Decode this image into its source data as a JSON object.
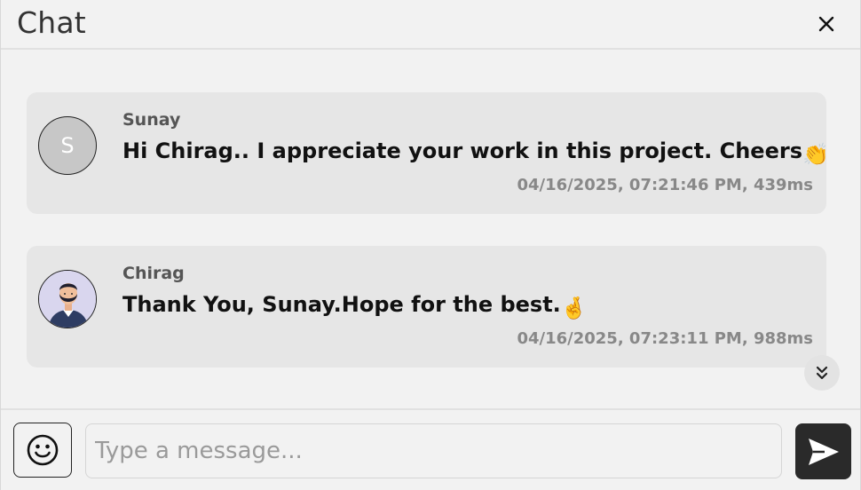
{
  "header": {
    "title": "Chat",
    "close_icon": "close-icon"
  },
  "messages": [
    {
      "sender": "Sunay",
      "avatar_initial": "S",
      "text": "Hi Chirag.. I appreciate your work in this project. Cheers",
      "emoji": "👏",
      "timestamp": "04/16/2025, 07:21:46 PM, 439ms"
    },
    {
      "sender": "Chirag",
      "avatar_icon": "user-avatar-icon",
      "text": "Thank You, Sunay.Hope for the best.",
      "emoji": "🤞",
      "timestamp": "04/16/2025, 07:23:11 PM, 988ms"
    }
  ],
  "scroll_down_icon": "double-chevron-down-icon",
  "composer": {
    "placeholder": "Type a message...",
    "value": "",
    "emoji_icon": "smiley-icon",
    "send_icon": "send-icon"
  },
  "colors": {
    "background": "#f2f2f2",
    "bubble": "#e6e6e6",
    "send_button": "#2a2a2a",
    "timestamp": "#888888"
  }
}
